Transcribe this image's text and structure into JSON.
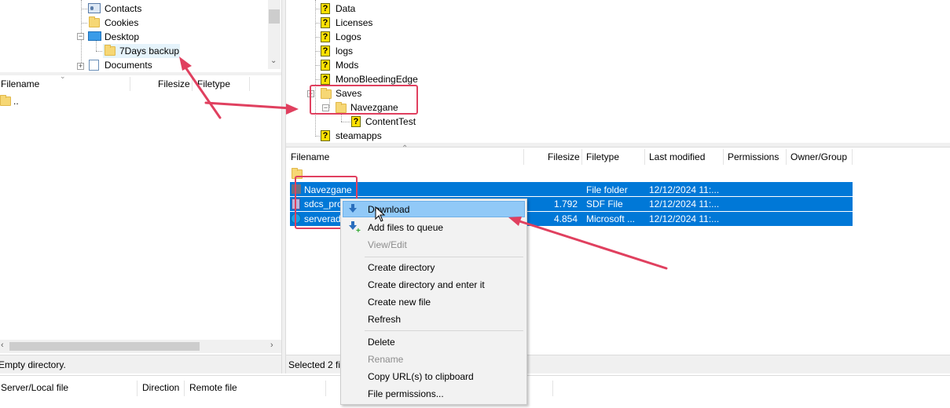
{
  "local_tree": {
    "items": [
      {
        "label": "Contacts",
        "icon": "contacts-icon"
      },
      {
        "label": "Cookies",
        "icon": "folder-icon"
      },
      {
        "label": "Desktop",
        "icon": "desktop-icon"
      },
      {
        "label": "7Days backup",
        "icon": "folder-icon"
      },
      {
        "label": "Documents",
        "icon": "documents-icon"
      }
    ]
  },
  "local_list": {
    "columns": [
      "Filename",
      "Filesize",
      "Filetype"
    ],
    "rows": [
      {
        "name": ".."
      }
    ],
    "status": "Empty directory."
  },
  "remote_tree": {
    "items": [
      {
        "label": "Data"
      },
      {
        "label": "Licenses"
      },
      {
        "label": "Logos"
      },
      {
        "label": "logs"
      },
      {
        "label": "Mods"
      },
      {
        "label": "MonoBleedingEdge"
      },
      {
        "label": "Saves"
      },
      {
        "label": "Navezgane"
      },
      {
        "label": "ContentTest"
      },
      {
        "label": "steamapps"
      }
    ]
  },
  "remote_list": {
    "columns": [
      "Filename",
      "Filesize",
      "Filetype",
      "Last modified",
      "Permissions",
      "Owner/Group"
    ],
    "rows": [
      {
        "name": "Navezgane",
        "size": "",
        "type": "File folder",
        "modified": "12/12/2024 11:..."
      },
      {
        "name": "sdcs_pro",
        "size": "1.792",
        "type": "SDF File",
        "modified": "12/12/2024 11:..."
      },
      {
        "name": "serveradı",
        "size": "4.854",
        "type": "Microsoft ...",
        "modified": "12/12/2024 11:..."
      }
    ],
    "status": "Selected 2 fil"
  },
  "queue": {
    "columns": [
      "Server/Local file",
      "Direction",
      "Remote file"
    ]
  },
  "context_menu": {
    "items": [
      {
        "label": "Download",
        "icon": "download-arrow-icon",
        "highlighted": true
      },
      {
        "label": "Add files to queue",
        "icon": "add-to-queue-icon"
      },
      {
        "label": "View/Edit",
        "disabled": true
      },
      {
        "label": "Create directory"
      },
      {
        "label": "Create directory and enter it"
      },
      {
        "label": "Create new file"
      },
      {
        "label": "Refresh"
      },
      {
        "label": "Delete"
      },
      {
        "label": "Rename",
        "disabled": true
      },
      {
        "label": "Copy URL(s) to clipboard"
      },
      {
        "label": "File permissions..."
      }
    ]
  },
  "colors": {
    "selection": "#0078d7",
    "menu_highlight": "#91c9f7",
    "annotation": "#e0405f"
  }
}
